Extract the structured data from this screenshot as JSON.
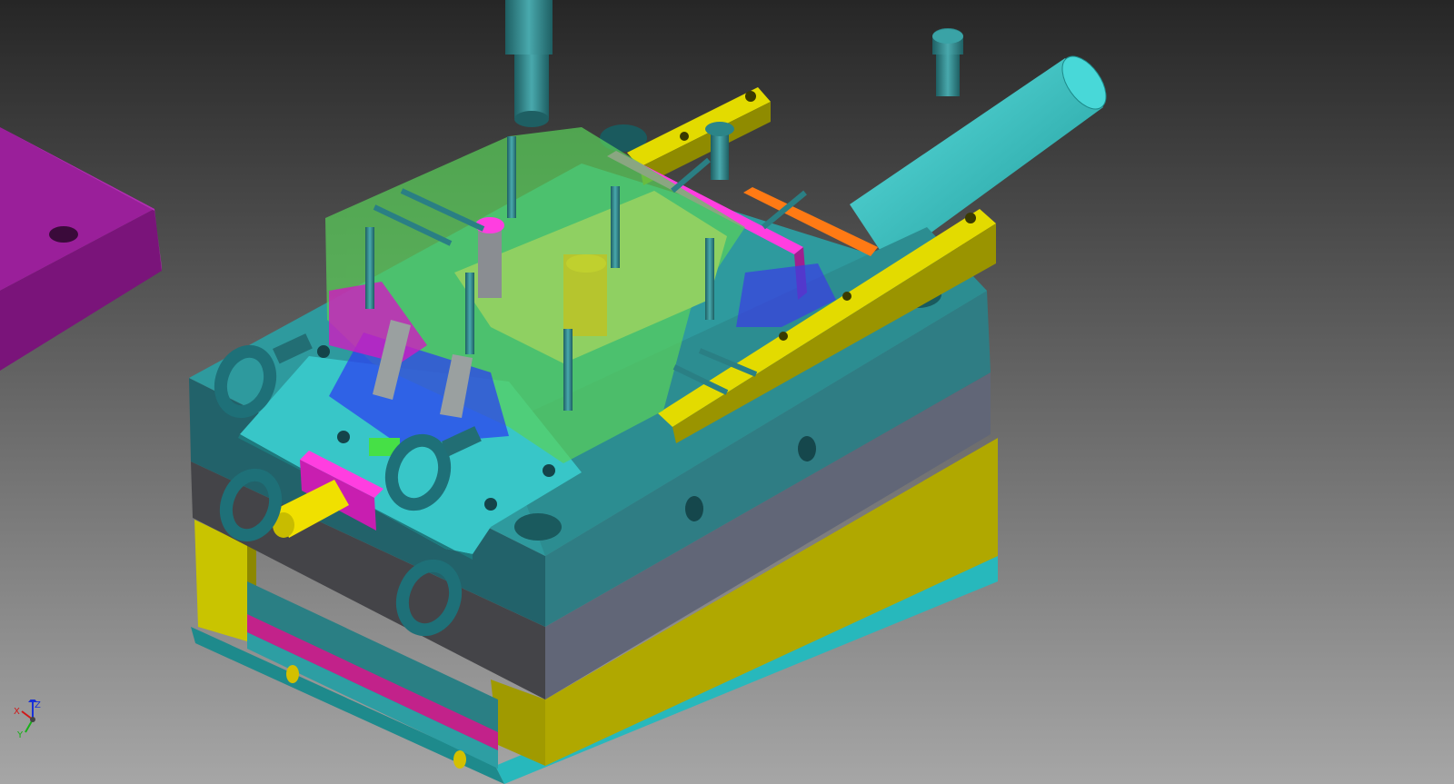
{
  "viewport": {
    "background_top": "#2a2a2a",
    "background_bottom": "#a4a4a4",
    "render_mode": "shaded-with-edges"
  },
  "colors": {
    "teal": "#2f7d82",
    "teal_top": "#34c9c9",
    "teal_dark": "#1c5a5e",
    "yellow": "#d9d400",
    "olive": "#8a8a12",
    "magenta": "#e62ed9",
    "purple": "#8c1a8c",
    "gray": "#5c5c66",
    "dark_gray": "#3c3c40",
    "orange": "#ff7a14",
    "green_translucent": "#4fd24f",
    "blue_translucent": "#2a3cff"
  },
  "axis_triad": {
    "x_label": "X",
    "y_label": "Y",
    "z_label": "Z",
    "x_color": "#d01818",
    "y_color": "#18b018",
    "z_color": "#1830d8"
  }
}
